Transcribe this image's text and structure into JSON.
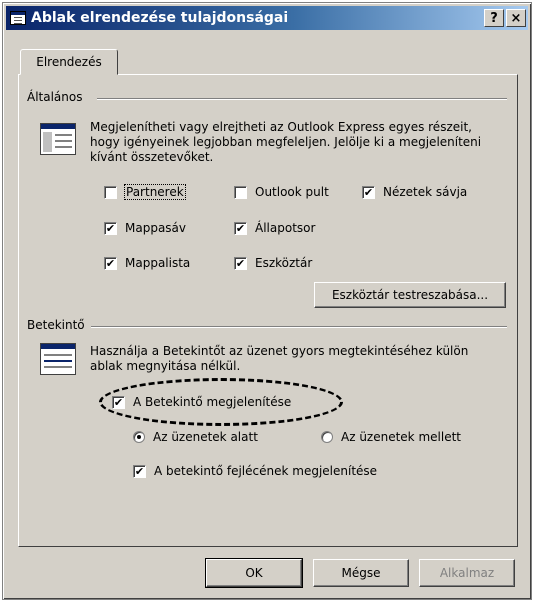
{
  "window": {
    "title": "Ablak elrendezése tulajdonságai",
    "help_glyph": "?",
    "close_glyph": "×"
  },
  "tab": {
    "label": "Elrendezés"
  },
  "general": {
    "label": "Általános",
    "description": "Megjelenítheti vagy elrejtheti az Outlook Express egyes részeit, hogy igényeinek legjobban megfeleljen. Jelölje ki a megjeleníteni kívánt összetevőket.",
    "checkboxes": [
      {
        "label": "Partnerek",
        "checked": false
      },
      {
        "label": "Outlook pult",
        "checked": false
      },
      {
        "label": "Nézetek sávja",
        "checked": true
      },
      {
        "label": "Mappasáv",
        "checked": true
      },
      {
        "label": "Állapotsor",
        "checked": true
      },
      {
        "label": "Mappalista",
        "checked": true
      },
      {
        "label": "Eszköztár",
        "checked": true
      }
    ],
    "customize_button": "Eszköztár testreszabása..."
  },
  "preview": {
    "label": "Betekintő",
    "description": "Használja a Betekintőt az üzenet gyors megtekintéséhez külön ablak megnyitása nélkül.",
    "show_preview": {
      "label": "A Betekintő megjelenítése",
      "checked": true
    },
    "radios": [
      {
        "label": "Az üzenetek alatt",
        "selected": true
      },
      {
        "label": "Az üzenetek mellett",
        "selected": false
      }
    ],
    "show_header": {
      "label": "A betekintő fejlécének megjelenítése",
      "checked": true
    }
  },
  "buttons": {
    "ok": "OK",
    "cancel": "Mégse",
    "apply": "Alkalmaz"
  },
  "colors": {
    "face": "#d4d0c8",
    "title_start": "#0a246a",
    "title_end": "#a6caf0"
  },
  "check_glyph": "✔"
}
